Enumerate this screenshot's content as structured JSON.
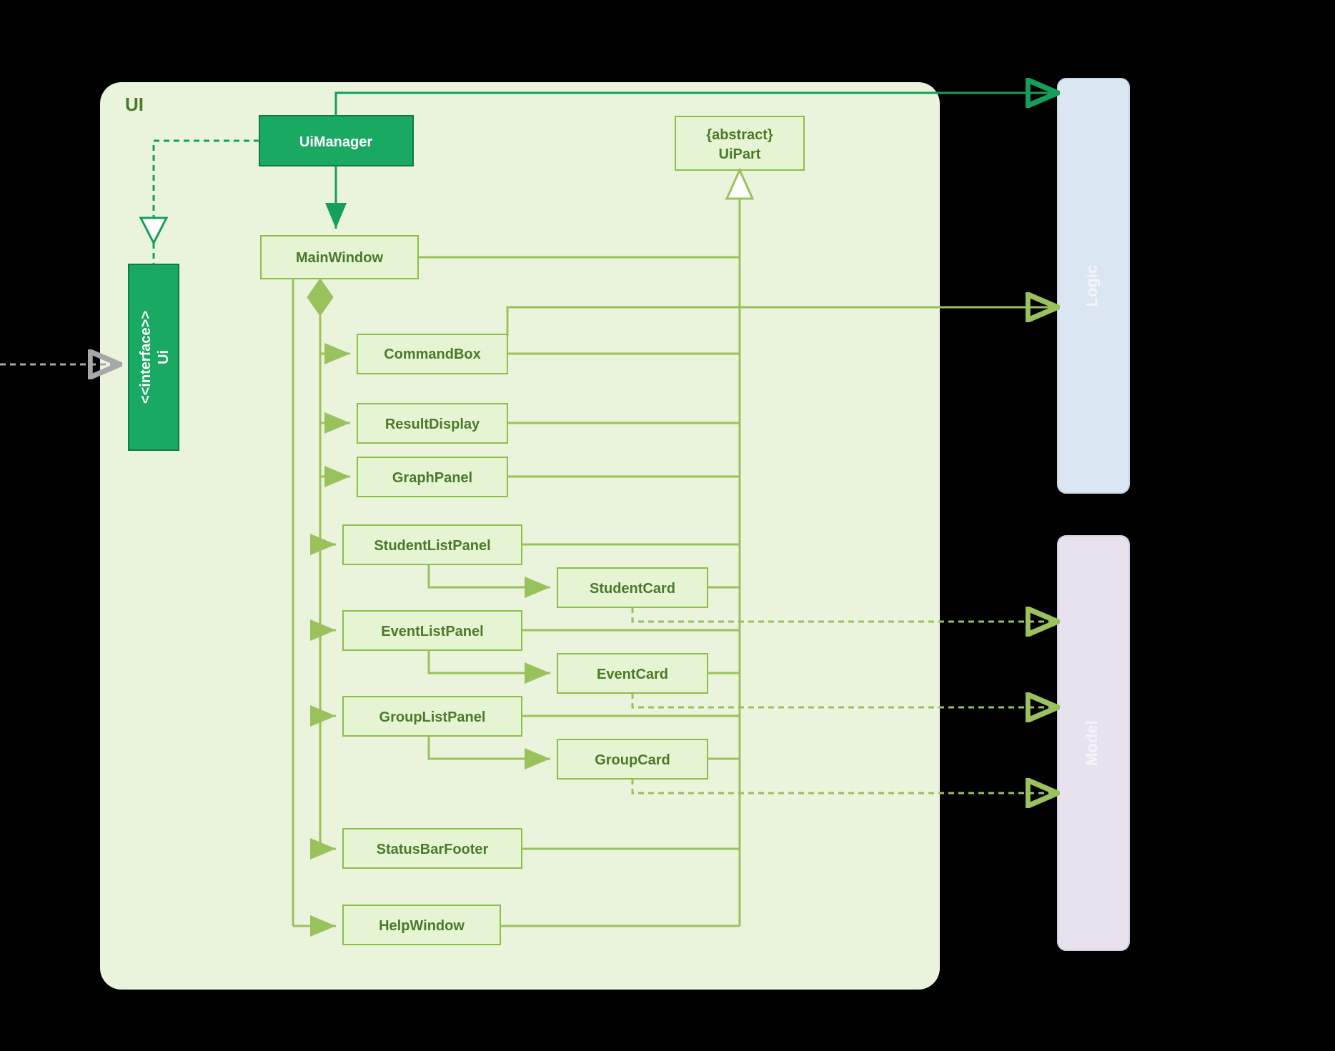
{
  "package": {
    "label": "UI"
  },
  "interface": {
    "stereotype": "<<interface>>",
    "name": "Ui"
  },
  "manager": "UiManager",
  "mainwindow": "MainWindow",
  "abstract": {
    "stereotype": "{abstract}",
    "name": "UiPart"
  },
  "parts": {
    "commandbox": "CommandBox",
    "resultdisplay": "ResultDisplay",
    "graphpanel": "GraphPanel",
    "studentlistpanel": "StudentListPanel",
    "studentcard": "StudentCard",
    "eventlistpanel": "EventListPanel",
    "eventcard": "EventCard",
    "grouplistpanel": "GroupListPanel",
    "groupcard": "GroupCard",
    "statusbarfooter": "StatusBarFooter",
    "helpwindow": "HelpWindow"
  },
  "external": {
    "logic": "Logic",
    "model": "Model"
  }
}
